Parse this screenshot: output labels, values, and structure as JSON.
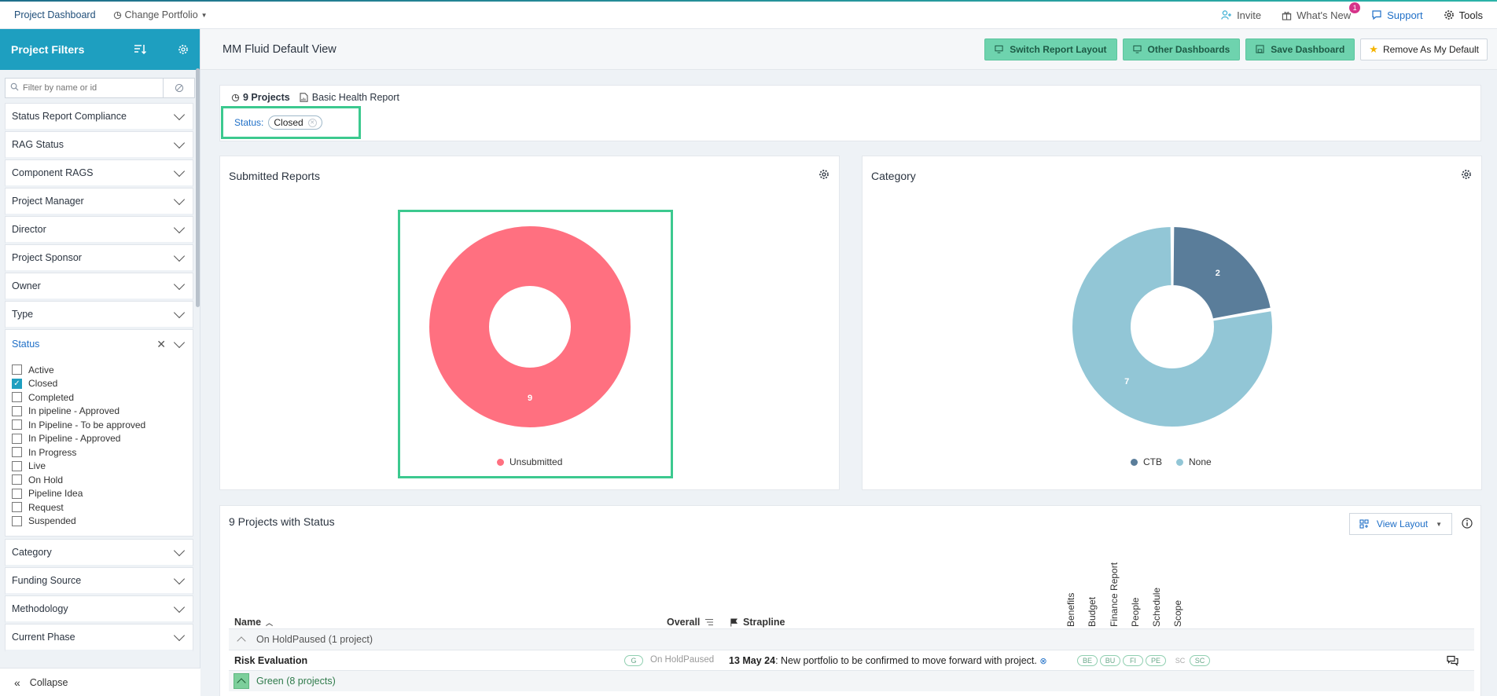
{
  "topbar": {
    "brand": "Project Dashboard",
    "change_portfolio": "Change Portfolio",
    "invite": "Invite",
    "whats_new": "What's New",
    "whats_new_badge": "1",
    "support": "Support",
    "tools": "Tools"
  },
  "sidebar": {
    "title": "Project Filters",
    "search_placeholder": "Filter by name or id",
    "filters_top": [
      "Status Report Compliance",
      "RAG Status",
      "Component RAGS",
      "Project Manager",
      "Director",
      "Project Sponsor",
      "Owner",
      "Type"
    ],
    "status": {
      "label": "Status",
      "options": [
        {
          "label": "Active",
          "checked": false
        },
        {
          "label": "Closed",
          "checked": true
        },
        {
          "label": "Completed",
          "checked": false
        },
        {
          "label": "In pipeline - Approved",
          "checked": false
        },
        {
          "label": "In Pipeline - To be approved",
          "checked": false
        },
        {
          "label": "In Pipeline - Approved",
          "checked": false
        },
        {
          "label": "In Progress",
          "checked": false
        },
        {
          "label": "Live",
          "checked": false
        },
        {
          "label": "On Hold",
          "checked": false
        },
        {
          "label": "Pipeline Idea",
          "checked": false
        },
        {
          "label": "Request",
          "checked": false
        },
        {
          "label": "Suspended",
          "checked": false
        }
      ]
    },
    "filters_bottom": [
      "Category",
      "Funding Source",
      "Methodology",
      "Current Phase"
    ],
    "collapse": "Collapse"
  },
  "header": {
    "title": "MM Fluid Default View",
    "switch_layout": "Switch Report Layout",
    "other_dashboards": "Other Dashboards",
    "save_dashboard": "Save Dashboard",
    "remove_default": "Remove As My Default"
  },
  "summary": {
    "projects": "9 Projects",
    "report": "Basic Health Report",
    "status_label": "Status:",
    "status_chip": "Closed"
  },
  "submitted": {
    "title": "Submitted Reports",
    "legend": [
      {
        "name": "Unsubmitted",
        "color": "#ff7080"
      }
    ]
  },
  "category": {
    "title": "Category",
    "legend": [
      {
        "name": "CTB",
        "color": "#5a7d9a"
      },
      {
        "name": "None",
        "color": "#92c6d6"
      }
    ]
  },
  "chart_data": [
    {
      "type": "pie",
      "title": "Submitted Reports",
      "categories": [
        "Unsubmitted"
      ],
      "values": [
        9
      ],
      "legend": "bottom"
    },
    {
      "type": "pie",
      "title": "Category",
      "categories": [
        "CTB",
        "None"
      ],
      "values": [
        2,
        7
      ],
      "legend": "bottom"
    }
  ],
  "table": {
    "title": "9 Projects with Status",
    "view_layout": "View Layout",
    "col_name": "Name",
    "col_overall": "Overall",
    "col_strapline": "Strapline",
    "rot_cols": [
      "Benefits",
      "Budget",
      "Finance Report",
      "People",
      "Schedule",
      "Scope"
    ],
    "group1": "On HoldPaused (1 project)",
    "row": {
      "name": "Risk Evaluation",
      "overall_pill": "G",
      "overall_text": "On HoldPaused",
      "date": "13 May 24",
      "strapline": ": New portfolio to be confirmed to move forward with project.",
      "pills": [
        "BE",
        "BU",
        "FI",
        "PE",
        "SC",
        "SC"
      ]
    },
    "group2": "Green (8 projects)"
  }
}
